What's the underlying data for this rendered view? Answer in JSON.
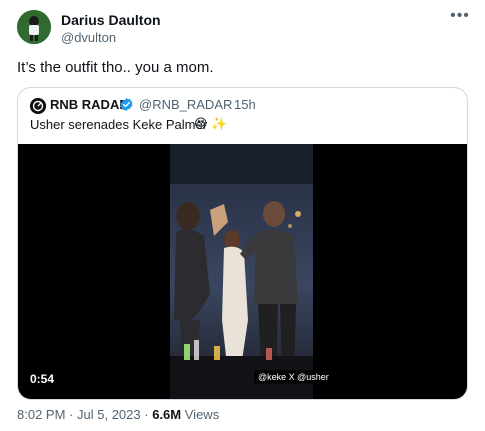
{
  "author": {
    "name": "Darius Daulton",
    "handle": "@dvulton",
    "avatar_icon": "avatar-image"
  },
  "more_icon": "more-dots-icon",
  "tweet_text": "It’s the outfit tho.. you a mom.",
  "quoted": {
    "name": "RNB RADAR",
    "handle": "@RNB_RADAR",
    "separator": "·",
    "time": "15h",
    "text": "Usher serenades Keke Palmer",
    "emoji_1": "😍",
    "emoji_2": "✨",
    "verified_icon": "verified-badge-icon",
    "video": {
      "duration": "0:54",
      "tag_label": "@keke X @usher"
    }
  },
  "meta": {
    "time": "8:02 PM",
    "separator": "·",
    "date": "Jul 5, 2023",
    "views_count": "6.6M",
    "views_label": "Views"
  },
  "colors": {
    "text": "#0f1419",
    "secondary": "#536471",
    "border": "#cfd9de",
    "verified": "#1d9bf0"
  }
}
